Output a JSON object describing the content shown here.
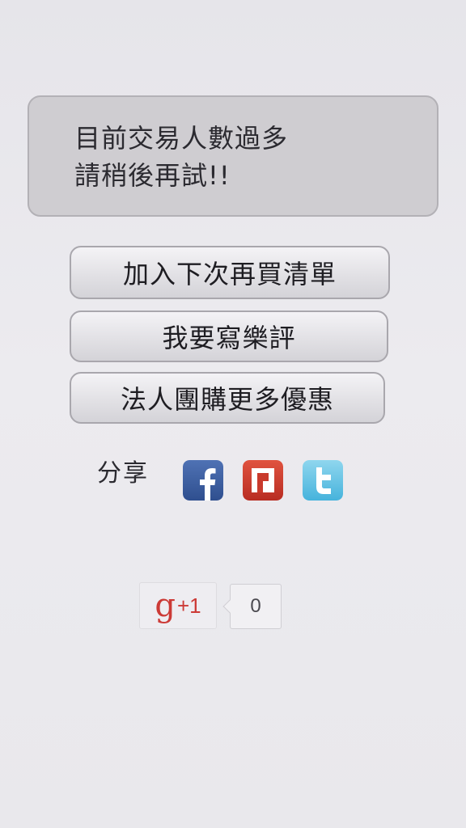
{
  "notice": {
    "line1": "目前交易人數過多",
    "line2": "請稍後再試!!"
  },
  "actions": {
    "add_to_next_list": "加入下次再買清單",
    "write_review": "我要寫樂評",
    "corporate_group_buy": "法人團購更多優惠"
  },
  "share": {
    "label": "分享",
    "icons": [
      "facebook-icon",
      "plurk-icon",
      "twitter-icon"
    ],
    "colors": {
      "facebook": "#3b5c9e",
      "plurk": "#cf3b2e",
      "twitter": "#4fbde3"
    }
  },
  "gplus": {
    "g": "g",
    "plus_one": "+1",
    "count": "0",
    "color": "#cc3a36"
  }
}
